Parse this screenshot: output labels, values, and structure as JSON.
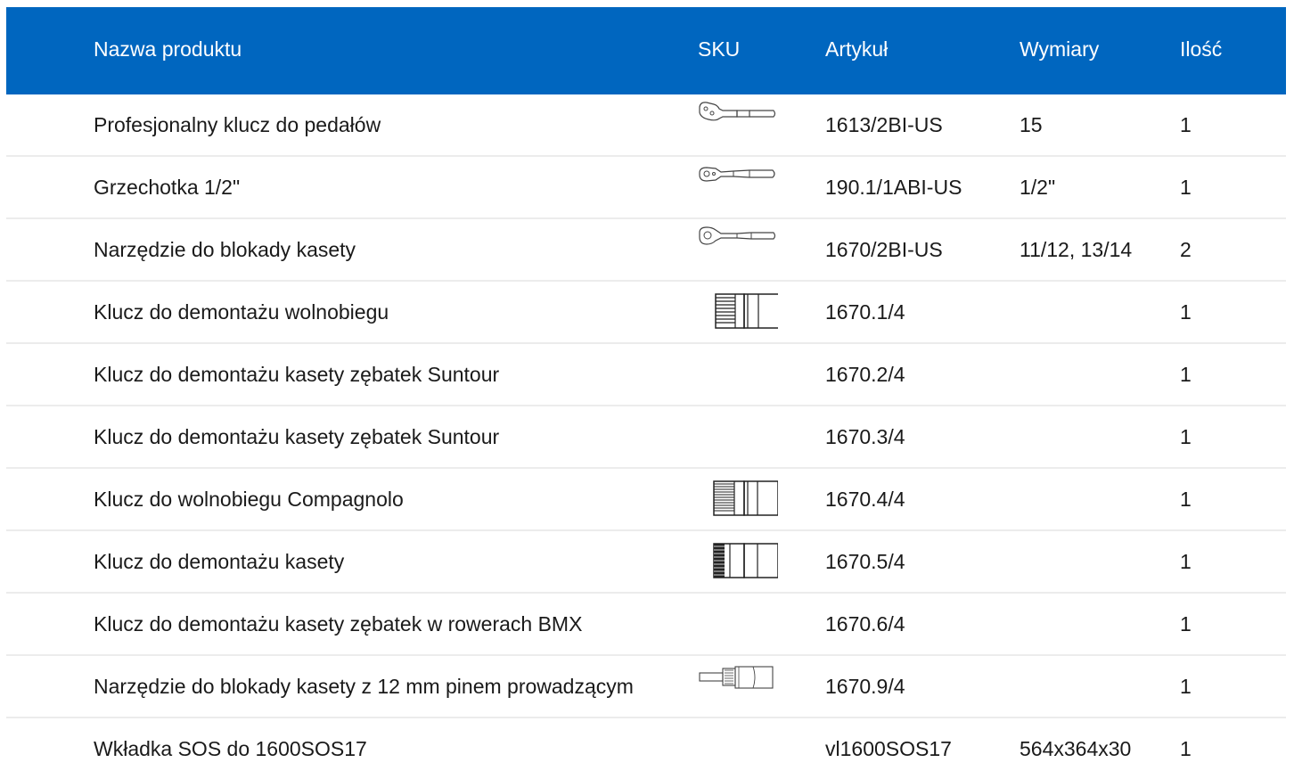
{
  "table": {
    "headers": {
      "name": "Nazwa produktu",
      "sku": "SKU",
      "article": "Artykuł",
      "dimensions": "Wymiary",
      "quantity": "Ilość"
    },
    "rows": [
      {
        "name": "Profesjonalny klucz do pedałów",
        "sku_icon": "pedal-wrench-icon",
        "article": "1613/2BI-US",
        "dimensions": "15",
        "quantity": "1"
      },
      {
        "name": "Grzechotka 1/2\"",
        "sku_icon": "ratchet-icon",
        "article": "190.1/1ABI-US",
        "dimensions": "1/2\"",
        "quantity": "1"
      },
      {
        "name": "Narzędzie do blokady kasety",
        "sku_icon": "cassette-lock-tool-icon",
        "article": "1670/2BI-US",
        "dimensions": "11/12, 13/14",
        "quantity": "2"
      },
      {
        "name": "Klucz do demontażu wolnobiegu",
        "sku_icon": "socket-tool-icon",
        "article": "1670.1/4",
        "dimensions": "",
        "quantity": "1"
      },
      {
        "name": "Klucz do demontażu kasety zębatek Suntour",
        "sku_icon": "",
        "article": "1670.2/4",
        "dimensions": "",
        "quantity": "1"
      },
      {
        "name": "Klucz do demontażu kasety zębatek Suntour",
        "sku_icon": "",
        "article": "1670.3/4",
        "dimensions": "",
        "quantity": "1"
      },
      {
        "name": "Klucz do wolnobiegu Compagnolo",
        "sku_icon": "socket-tool-icon",
        "article": "1670.4/4",
        "dimensions": "",
        "quantity": "1"
      },
      {
        "name": "Klucz do demontażu kasety",
        "sku_icon": "socket-tool-dense-icon",
        "article": "1670.5/4",
        "dimensions": "",
        "quantity": "1"
      },
      {
        "name": "Klucz do demontażu kasety zębatek w rowerach BMX",
        "sku_icon": "",
        "article": "1670.6/4",
        "dimensions": "",
        "quantity": "1"
      },
      {
        "name": "Narzędzie do blokady kasety z 12 mm pinem prowadzącym",
        "sku_icon": "pin-socket-tool-icon",
        "article": "1670.9/4",
        "dimensions": "",
        "quantity": "1"
      },
      {
        "name": "Wkładka SOS do 1600SOS17",
        "sku_icon": "",
        "article": "vl1600SOS17",
        "dimensions": "564x364x30",
        "quantity": "1"
      }
    ]
  },
  "colors": {
    "header_bg": "#0066bf",
    "header_text": "#ffffff",
    "row_divider": "#ececec",
    "text": "#1a1a1a"
  }
}
